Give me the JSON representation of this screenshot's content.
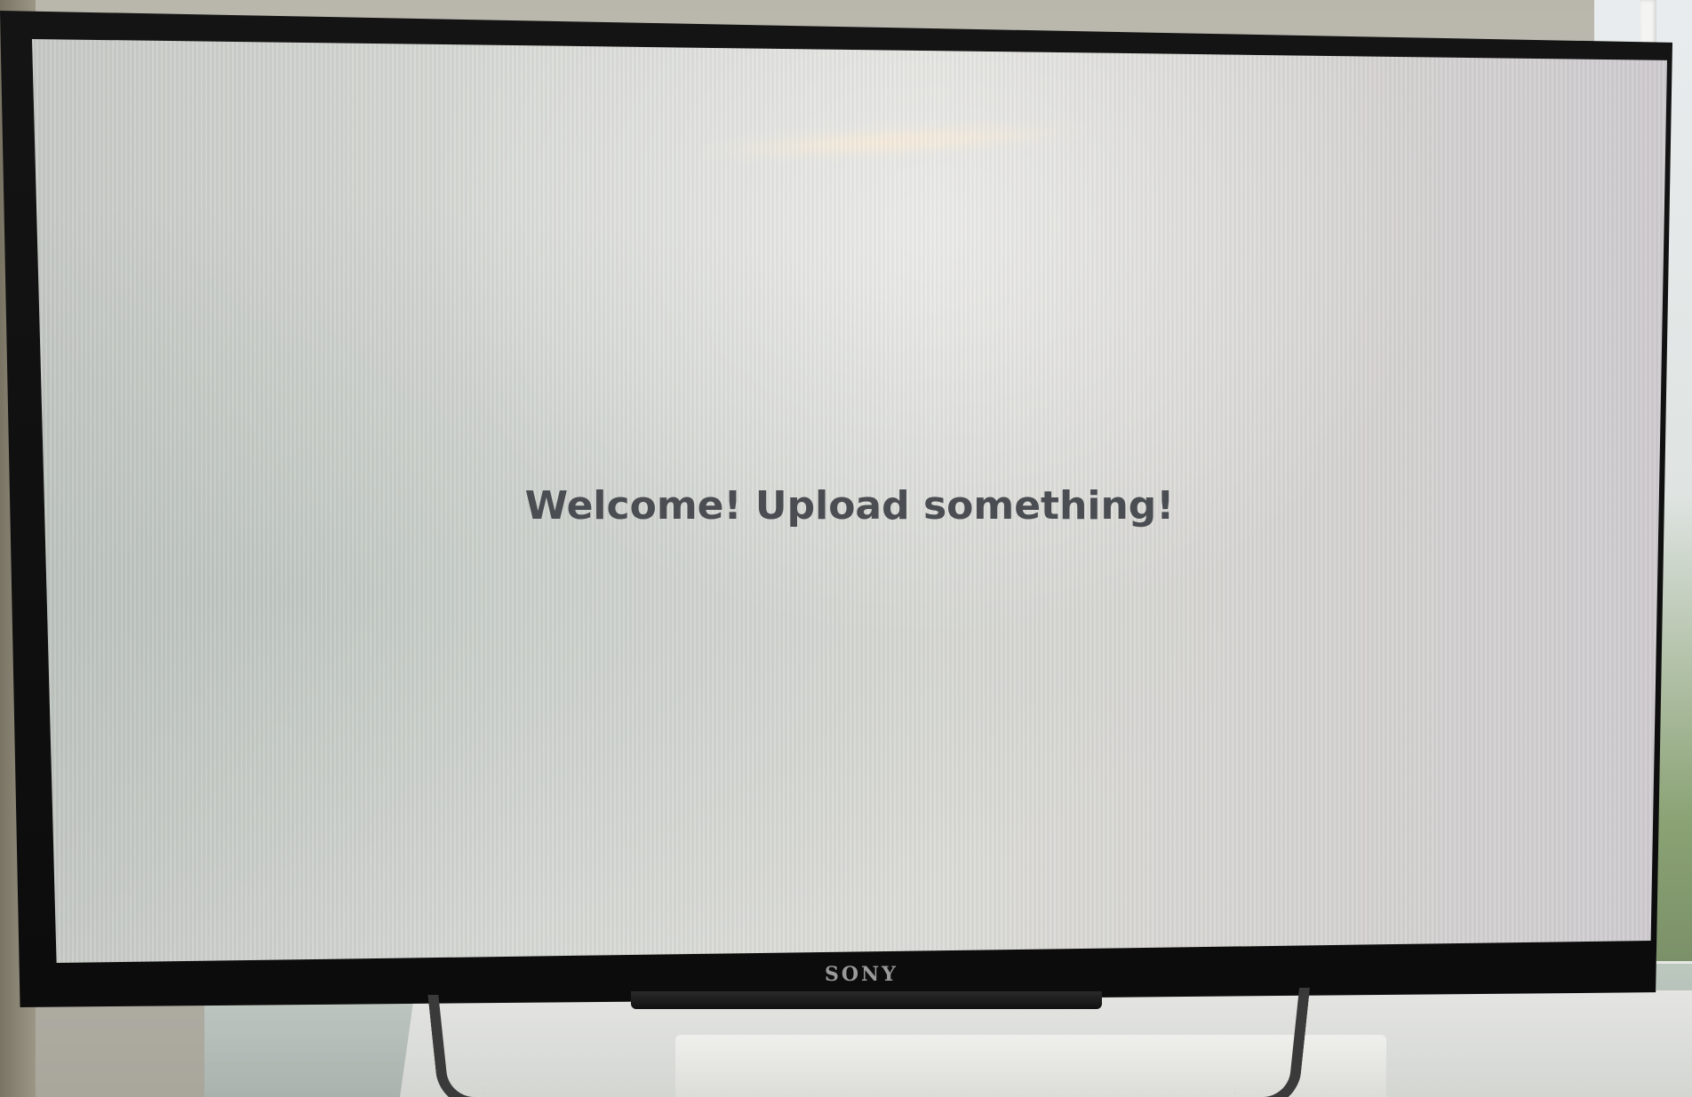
{
  "screen": {
    "message": "Welcome! Upload something!"
  },
  "tv": {
    "brand": "SONY"
  }
}
